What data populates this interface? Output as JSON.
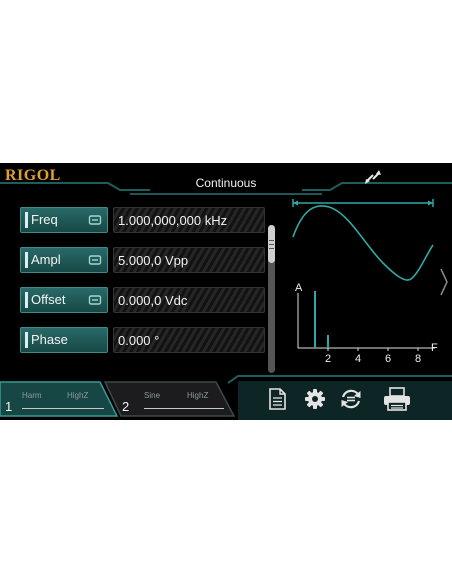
{
  "header": {
    "brand": "RIGOL",
    "mode": "Continuous",
    "link_icon": "sync-arrows-icon"
  },
  "params": [
    {
      "label": "Freq",
      "value": "1.000,000,000 kHz",
      "has_unit_toggle": true
    },
    {
      "label": "Ampl",
      "value": "5.000,0 Vpp",
      "has_unit_toggle": true
    },
    {
      "label": "Offset",
      "value": "0.000,0 Vdc",
      "has_unit_toggle": true
    },
    {
      "label": "Phase",
      "value": "0.000 °",
      "has_unit_toggle": false
    }
  ],
  "preview": {
    "axis_a": "A",
    "axis_f": "F",
    "ticks": [
      "2",
      "4",
      "6",
      "8"
    ]
  },
  "channels": [
    {
      "number": "1",
      "type": "Harm",
      "load": "HighZ",
      "active": true
    },
    {
      "number": "2",
      "type": "Sine",
      "load": "HighZ",
      "active": false
    }
  ],
  "toolbar": [
    "document-icon",
    "gear-icon",
    "sync-icon",
    "printer-icon"
  ],
  "colors": {
    "accent": "#2a6b69",
    "brand": "#e0a12a",
    "background": "#000000",
    "frame": "#1d5e5c"
  }
}
